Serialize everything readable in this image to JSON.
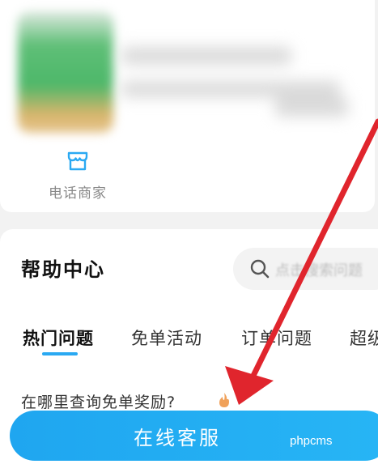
{
  "merchant": {
    "call_label": "电话商家"
  },
  "help": {
    "title": "帮助中心",
    "search_placeholder": "点击搜索问题",
    "tabs": [
      {
        "label": "热门问题",
        "active": true
      },
      {
        "label": "免单活动",
        "active": false
      },
      {
        "label": "订单问题",
        "active": false
      },
      {
        "label": "超级",
        "active": false
      }
    ],
    "question": "在哪里查询免单奖励?"
  },
  "footer": {
    "customer_service_label": "在线客服",
    "watermark": "phpcms"
  },
  "colors": {
    "accent": "#1fa6f0",
    "arrow": "#e0252d"
  }
}
